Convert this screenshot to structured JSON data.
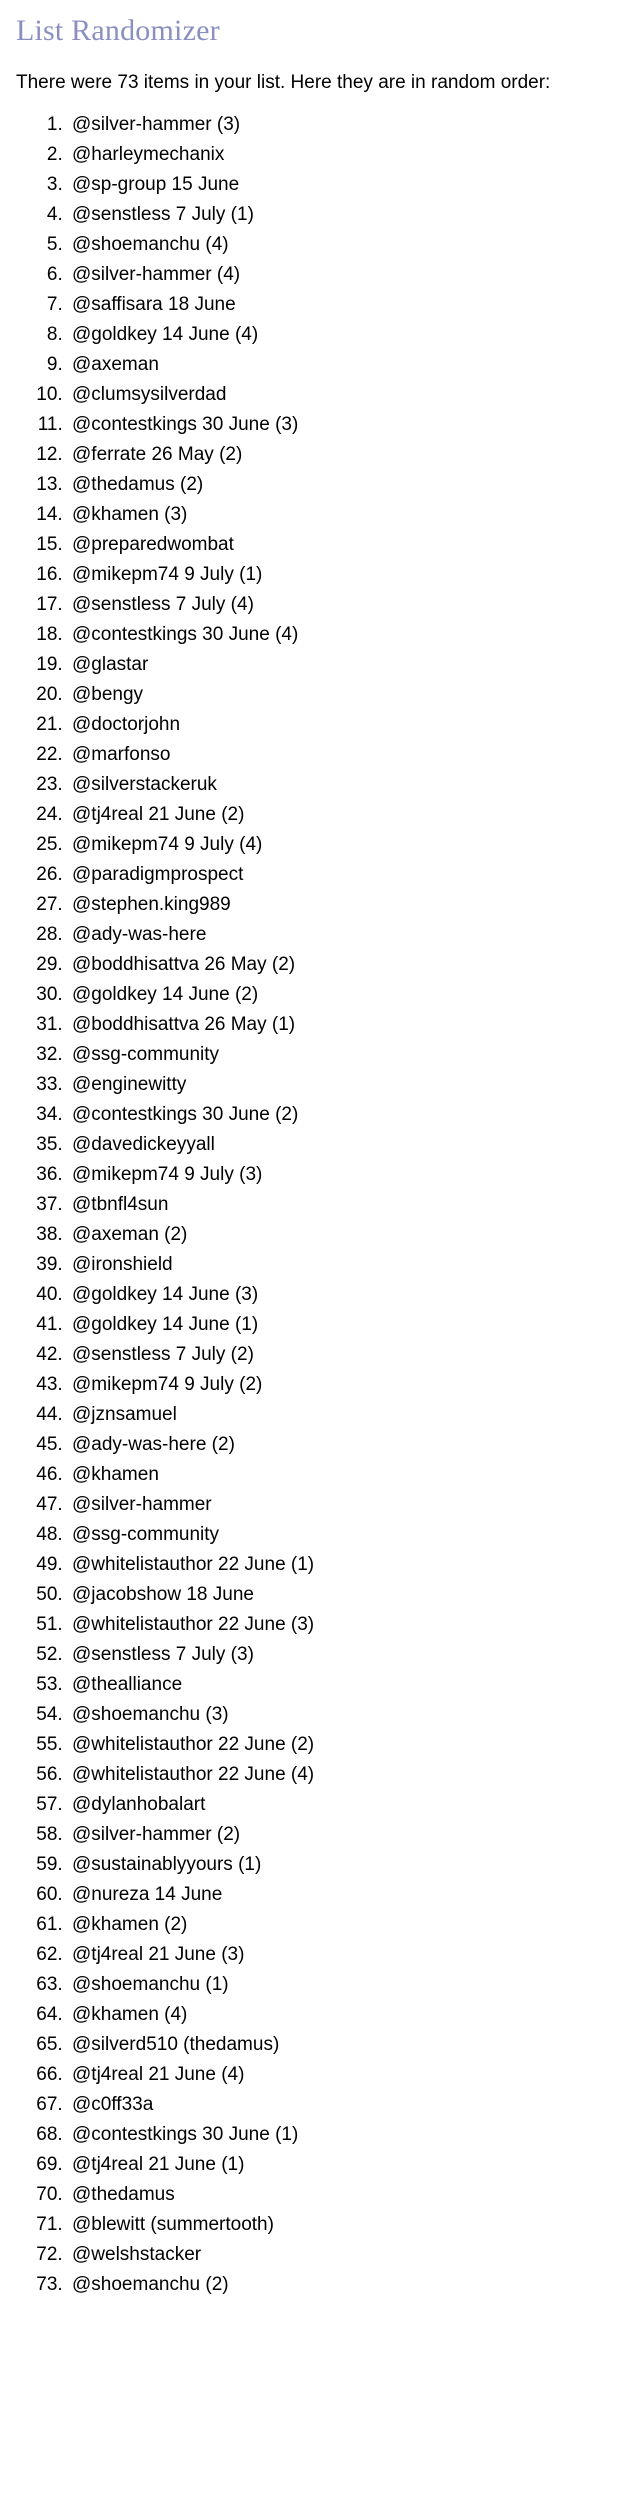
{
  "page": {
    "title": "List Randomizer",
    "title_color": "#8a8fc0",
    "intro": "There were 73 items in your list. Here they are in random order:",
    "item_count": 73
  },
  "results": {
    "items": [
      "@silver-hammer (3)",
      "@harleymechanix",
      "@sp-group 15 June",
      "@senstless 7 July (1)",
      "@shoemanchu (4)",
      "@silver-hammer (4)",
      "@saffisara 18 June",
      "@goldkey 14 June (4)",
      "@axeman",
      "@clumsysilverdad",
      "@contestkings 30 June (3)",
      "@ferrate 26 May (2)",
      "@thedamus (2)",
      "@khamen (3)",
      "@preparedwombat",
      "@mikepm74 9 July (1)",
      "@senstless 7 July (4)",
      "@contestkings 30 June (4)",
      "@glastar",
      "@bengy",
      "@doctorjohn",
      "@marfonso",
      "@silverstackeruk",
      "@tj4real 21 June (2)",
      "@mikepm74 9 July (4)",
      "@paradigmprospect",
      "@stephen.king989",
      "@ady-was-here",
      "@boddhisattva 26 May (2)",
      "@goldkey 14 June (2)",
      "@boddhisattva 26 May (1)",
      "@ssg-community",
      "@enginewitty",
      "@contestkings 30 June (2)",
      "@davedickeyyall",
      "@mikepm74 9 July (3)",
      "@tbnfl4sun",
      "@axeman (2)",
      "@ironshield",
      "@goldkey 14 June (3)",
      "@goldkey 14 June (1)",
      "@senstless 7 July (2)",
      "@mikepm74 9 July (2)",
      "@jznsamuel",
      "@ady-was-here (2)",
      "@khamen",
      "@silver-hammer",
      "@ssg-community",
      "@whitelistauthor 22 June (1)",
      "@jacobshow 18 June",
      "@whitelistauthor 22 June (3)",
      "@senstless 7 July (3)",
      "@thealliance",
      "@shoemanchu (3)",
      "@whitelistauthor 22 June (2)",
      "@whitelistauthor 22 June (4)",
      "@dylanhobalart",
      "@silver-hammer (2)",
      "@sustainablyyours (1)",
      "@nureza 14 June",
      "@khamen (2)",
      "@tj4real 21 June (3)",
      "@shoemanchu (1)",
      "@khamen (4)",
      "@silverd510 (thedamus)",
      "@tj4real 21 June (4)",
      "@c0ff33a",
      "@contestkings 30 June (1)",
      "@tj4real 21 June (1)",
      "@thedamus",
      "@blewitt (summertooth)",
      "@welshstacker",
      "@shoemanchu (2)"
    ]
  }
}
